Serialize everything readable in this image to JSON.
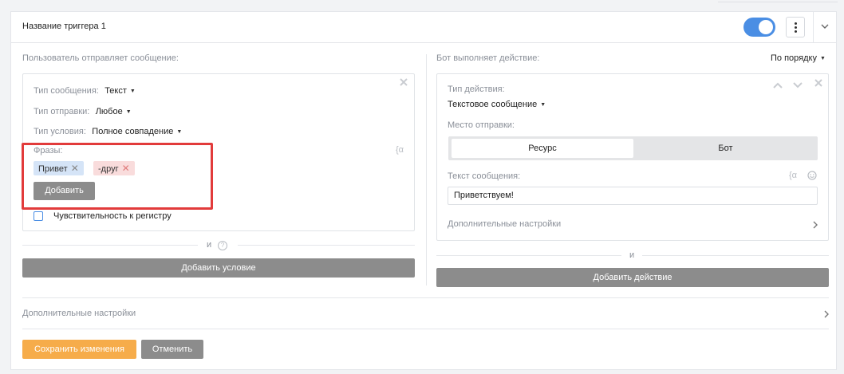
{
  "header": {
    "title": "Название триггера 1",
    "toggle_on": true
  },
  "left": {
    "section_label": "Пользователь отправляет сообщение:",
    "message_type_label": "Тип сообщения:",
    "message_type_value": "Текст",
    "send_type_label": "Тип отправки:",
    "send_type_value": "Любое",
    "condition_type_label": "Тип условия:",
    "condition_type_value": "Полное совпадение",
    "phrases_label": "Фразы:",
    "phrases": [
      {
        "text": "Привет",
        "kind": "include"
      },
      {
        "text": "-друг",
        "kind": "exclude"
      }
    ],
    "add_label": "Добавить",
    "case_sensitive_label": "Чувствительность к регистру",
    "case_sensitive_checked": false,
    "and_label": "и",
    "add_condition_label": "Добавить условие"
  },
  "right": {
    "section_label": "Бот выполняет действие:",
    "order_value": "По порядку",
    "action_type_label": "Тип действия:",
    "action_type_value": "Текстовое сообщение",
    "send_place_label": "Место отправки:",
    "send_place_options": [
      "Ресурс",
      "Бот"
    ],
    "send_place_selected": "Ресурс",
    "message_text_label": "Текст сообщения:",
    "message_text_value": "Приветствуем!",
    "extra_settings_label": "Дополнительные настройки",
    "and_label": "и",
    "add_action_label": "Добавить действие"
  },
  "footer": {
    "extra_settings_label": "Дополнительные настройки",
    "save_label": "Сохранить изменения",
    "cancel_label": "Отменить"
  },
  "colors": {
    "accent_blue": "#4a8ee4",
    "save_orange": "#f6ac4a",
    "highlight_red": "#e23b3b",
    "button_gray": "#8c8c8c"
  },
  "icons": {
    "variable": "variable-icon",
    "emoji": "emoji-icon",
    "close": "close-icon",
    "chevron_down": "chevron-down-icon",
    "chevron_up": "chevron-up-icon",
    "chevron_right": "chevron-right-icon",
    "kebab": "kebab-menu-icon",
    "help": "help-icon"
  }
}
